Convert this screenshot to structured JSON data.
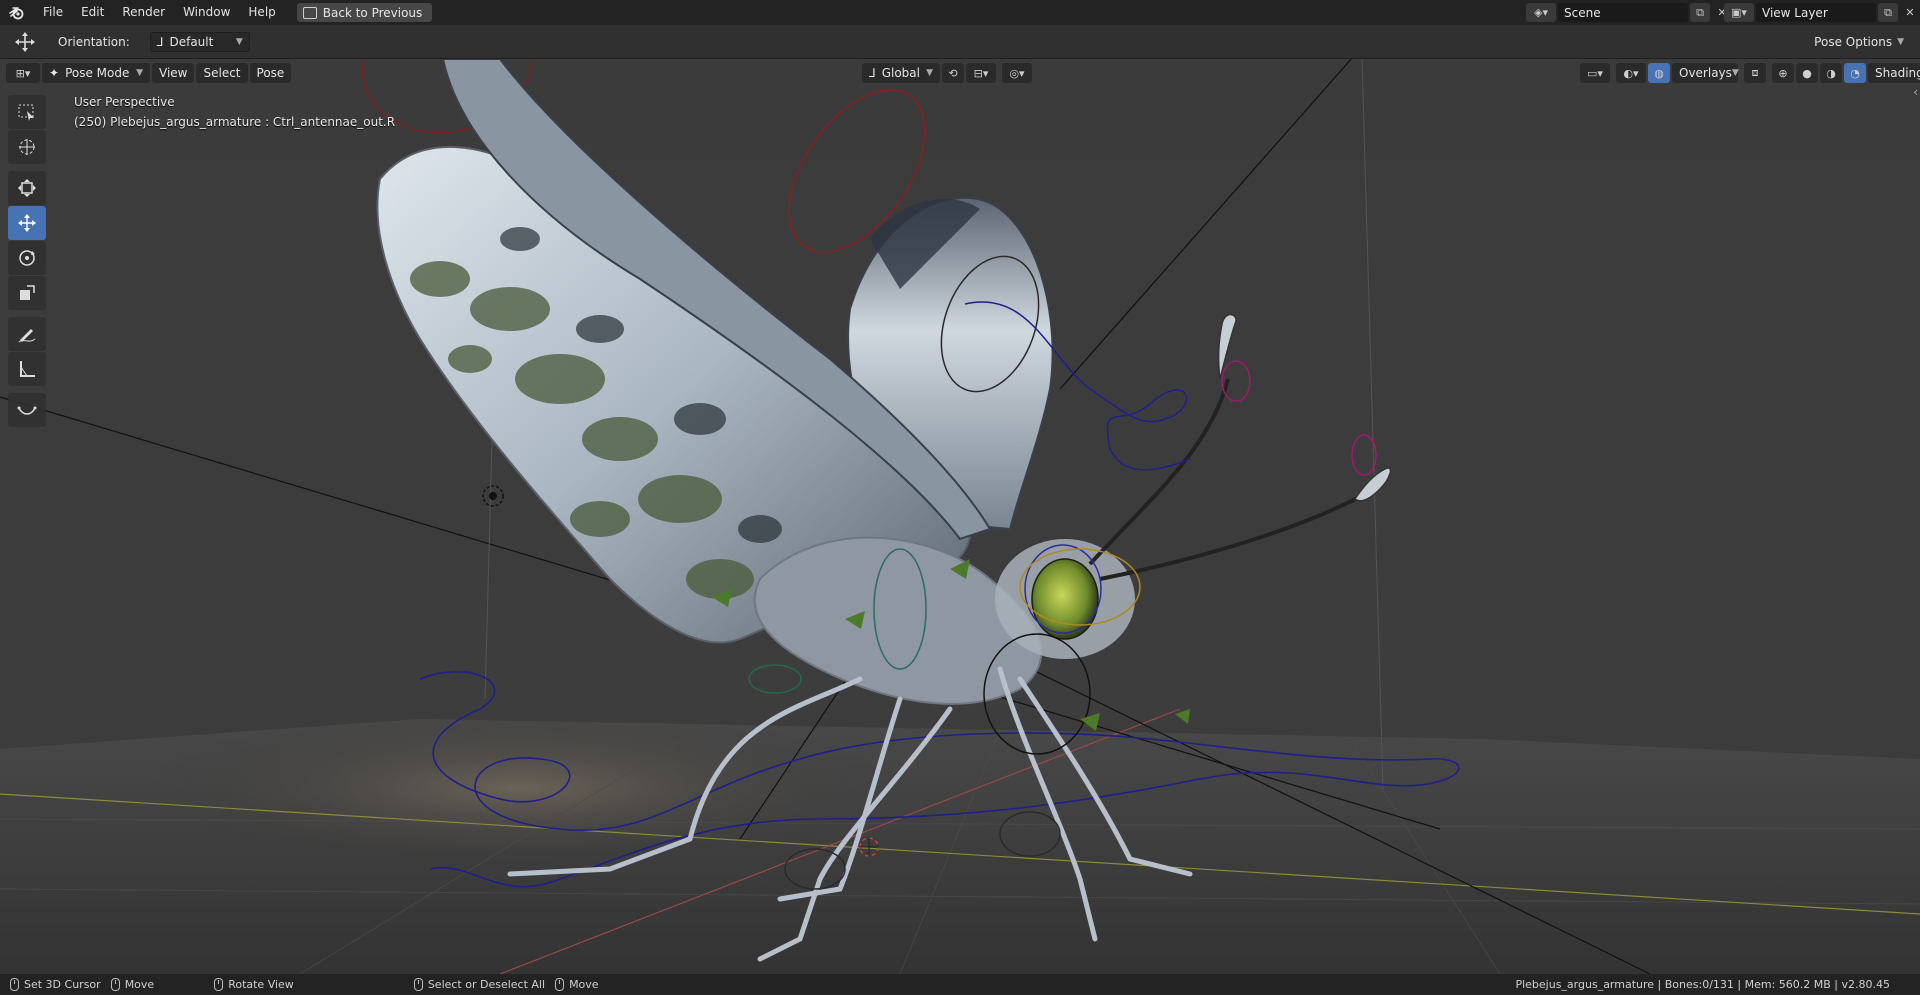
{
  "menubar": {
    "items": [
      "File",
      "Edit",
      "Render",
      "Window",
      "Help"
    ],
    "back_label": "Back to Previous",
    "scene_value": "Scene",
    "view_layer_value": "View Layer"
  },
  "tool_settings": {
    "orientation_label": "Orientation:",
    "orientation_value": "Default",
    "pose_options_label": "Pose Options"
  },
  "viewport_header": {
    "mode": "Pose Mode",
    "menus": [
      "View",
      "Select",
      "Pose"
    ],
    "transform_orientation": "Global",
    "overlays_label": "Overlays",
    "shading_label": "Shading"
  },
  "viewport_info": {
    "perspective": "User Perspective",
    "object_line": "(250) Plebejus_argus_armature : Ctrl_antennae_out.R"
  },
  "tools": [
    "select-box",
    "cursor",
    "move",
    "transform-move",
    "rotate",
    "scale",
    "annotate",
    "measure",
    "curve"
  ],
  "statusbar": {
    "items": [
      "Set 3D Cursor",
      "Move",
      "Rotate View",
      "Select or Deselect All",
      "Move"
    ],
    "right_info": "Plebejus_argus_armature | Bones:0/131 | Mem: 560.2 MB | v2.80.45"
  },
  "colors": {
    "accent": "#4772b3",
    "header_bg": "#232323",
    "toolbar_bg": "#303030",
    "viewport_bg": "#3d3d3d"
  }
}
